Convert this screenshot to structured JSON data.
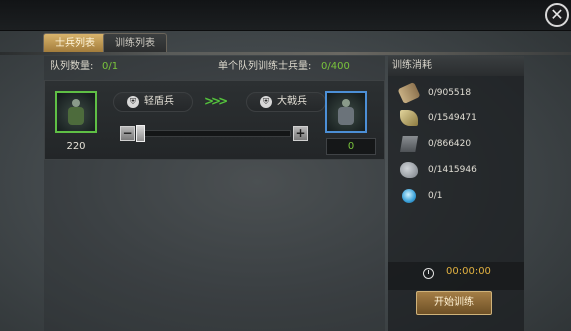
{
  "tabs": [
    {
      "label": "士兵列表",
      "active": true
    },
    {
      "label": "训练列表",
      "active": false
    }
  ],
  "info": {
    "queue_label": "队列数量:",
    "queue_value": "0/1",
    "max_label": "单个队列训练士兵量:",
    "max_value": "0/400"
  },
  "upgrade": {
    "source_count": "220",
    "source_name": "轻盾兵",
    "target_name": "大戟兵",
    "amount": "0",
    "slider_fraction": 0
  },
  "cost_panel": {
    "title": "训练消耗",
    "resources": [
      {
        "icon": "wood-icon",
        "value": "0/905518"
      },
      {
        "icon": "feather-icon",
        "value": "0/1549471"
      },
      {
        "icon": "iron-ingot-icon",
        "value": "0/866420"
      },
      {
        "icon": "stone-icon",
        "value": "0/1415946"
      },
      {
        "icon": "gem-icon",
        "value": "0/1"
      }
    ],
    "time": "00:00:00",
    "start_label": "开始训练"
  },
  "close_label": "✕",
  "colors": {
    "accent_green": "#79c43c",
    "timer": "#e0b040",
    "button": "#a47e46"
  }
}
